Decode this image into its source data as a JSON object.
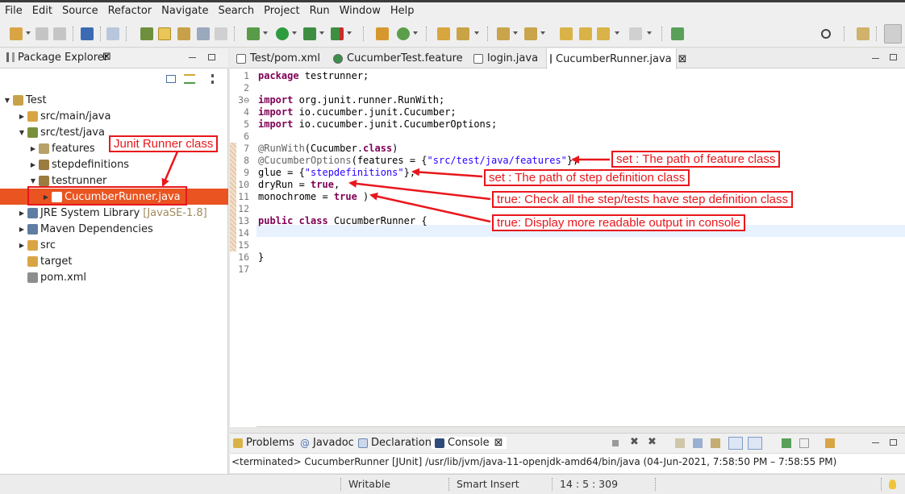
{
  "menubar": [
    "File",
    "Edit",
    "Source",
    "Refactor",
    "Navigate",
    "Search",
    "Project",
    "Run",
    "Window",
    "Help"
  ],
  "package_explorer": {
    "title": "Package Explorer",
    "close_glyph": "⊠",
    "tree": [
      {
        "label": "Test",
        "suffix": "",
        "selected": false
      },
      {
        "label": "src/main/java",
        "suffix": "",
        "selected": false
      },
      {
        "label": "src/test/java",
        "suffix": "",
        "selected": false
      },
      {
        "label": "features",
        "suffix": "",
        "selected": false
      },
      {
        "label": "stepdefinitions",
        "suffix": "",
        "selected": false
      },
      {
        "label": "testrunner",
        "suffix": "",
        "selected": false
      },
      {
        "label": "CucumberRunner.java",
        "suffix": "",
        "selected": true
      },
      {
        "label": "JRE System Library",
        "suffix": "[JavaSE-1.8]",
        "selected": false
      },
      {
        "label": "Maven Dependencies",
        "suffix": "",
        "selected": false
      },
      {
        "label": "src",
        "suffix": "",
        "selected": false
      },
      {
        "label": "target",
        "suffix": "",
        "selected": false
      },
      {
        "label": "pom.xml",
        "suffix": "",
        "selected": false
      }
    ]
  },
  "editor": {
    "tabs": [
      {
        "label": "Test/pom.xml",
        "active": false
      },
      {
        "label": "CucumberTest.feature",
        "active": false
      },
      {
        "label": "login.java",
        "active": false
      },
      {
        "label": "CucumberRunner.java",
        "active": true
      }
    ],
    "tab_close_glyph": "⊠",
    "code": [
      {
        "n": "1",
        "parts": [
          [
            "kw",
            "package"
          ],
          [
            "",
            " testrunner;"
          ]
        ]
      },
      {
        "n": "2",
        "parts": []
      },
      {
        "n": "3⊖",
        "parts": [
          [
            "kw",
            "import"
          ],
          [
            "",
            " org.junit.runner.RunWith;"
          ]
        ]
      },
      {
        "n": "4",
        "parts": [
          [
            "kw",
            "import"
          ],
          [
            "",
            " io.cucumber.junit.Cucumber;"
          ]
        ]
      },
      {
        "n": "5",
        "parts": [
          [
            "kw",
            "import"
          ],
          [
            "",
            " io.cucumber.junit.CucumberOptions;"
          ]
        ]
      },
      {
        "n": "6",
        "parts": []
      },
      {
        "n": "7",
        "parts": [
          [
            "ann",
            "@RunWith"
          ],
          [
            "",
            "(Cucumber."
          ],
          [
            "kw",
            "class"
          ],
          [
            "",
            ")"
          ]
        ]
      },
      {
        "n": "8",
        "parts": [
          [
            "ann",
            "@CucumberOptions"
          ],
          [
            "",
            "(features = {"
          ],
          [
            "str",
            "\"src/test/java/features\""
          ],
          [
            "",
            "},"
          ]
        ]
      },
      {
        "n": "9",
        "parts": [
          [
            "",
            "glue = {"
          ],
          [
            "str",
            "\"stepdefinitions\""
          ],
          [
            "",
            "},"
          ]
        ]
      },
      {
        "n": "10",
        "parts": [
          [
            "",
            "dryRun = "
          ],
          [
            "kw",
            "true"
          ],
          [
            "",
            ","
          ]
        ]
      },
      {
        "n": "11",
        "parts": [
          [
            "",
            "monochrome = "
          ],
          [
            "kw",
            "true"
          ],
          [
            "",
            " )"
          ]
        ]
      },
      {
        "n": "12",
        "parts": []
      },
      {
        "n": "13",
        "parts": [
          [
            "kw",
            "public"
          ],
          [
            "",
            " "
          ],
          [
            "kw",
            "class"
          ],
          [
            "",
            " CucumberRunner {"
          ]
        ]
      },
      {
        "n": "14",
        "parts": []
      },
      {
        "n": "15",
        "parts": []
      },
      {
        "n": "16",
        "parts": [
          [
            "",
            "}"
          ]
        ]
      },
      {
        "n": "17",
        "parts": []
      }
    ]
  },
  "console": {
    "tabs": [
      "Problems",
      "Javadoc",
      "Declaration",
      "Console"
    ],
    "text": "<terminated> CucumberRunner [JUnit] /usr/lib/jvm/java-11-openjdk-amd64/bin/java  (04-Jun-2021, 7:58:50 PM – 7:58:55 PM)"
  },
  "statusbar": {
    "writable": "Writable",
    "insert_mode": "Smart Insert",
    "position": "14 : 5 : 309"
  },
  "annotations": {
    "junit_runner": "Junit Runner class",
    "features": "set : The path of feature class",
    "glue": "set : The path of step definition class",
    "dryrun": "true: Check all the step/tests have step definition class",
    "monochrome": "true:  Display more readable output in console"
  },
  "colors": {
    "selection": "#e95420",
    "annotation_red": "#e8171c",
    "keyword": "#7f0055",
    "string": "#2a00ff"
  }
}
